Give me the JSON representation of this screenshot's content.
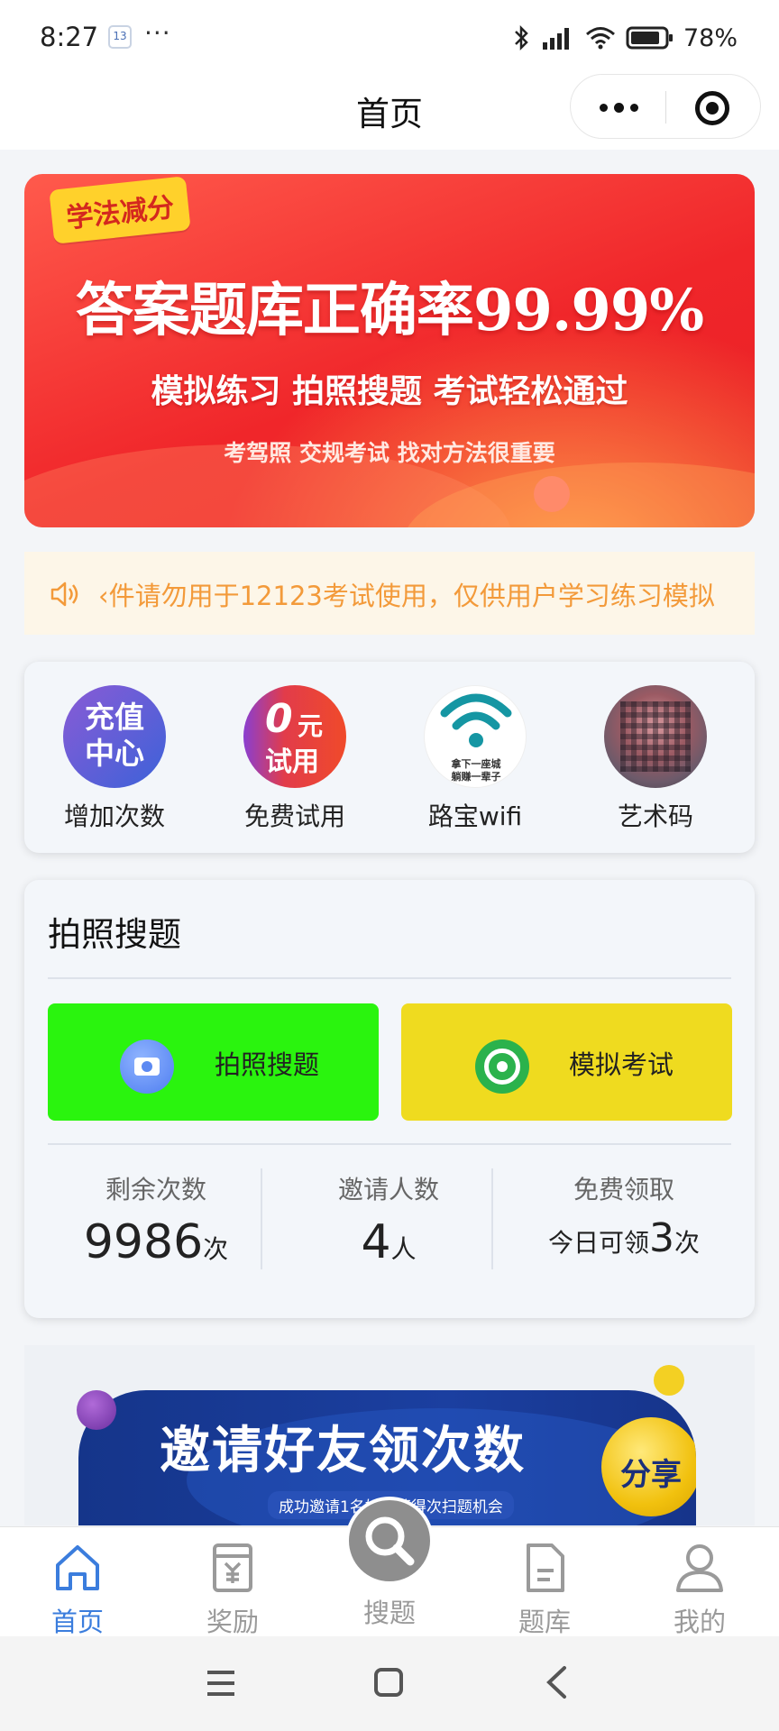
{
  "status_bar": {
    "time": "8:27",
    "calendar_badge": "13",
    "more_dots": "···",
    "battery_text": "78%"
  },
  "header": {
    "title": "首页"
  },
  "banner": {
    "tag": "学法减分",
    "headline": "答案题库正确率99.99%",
    "subline": "模拟练习 拍照搜题 考试轻松通过",
    "note": "考驾照 交规考试 找对方法很重要"
  },
  "notice": {
    "text": "‹件请勿用于12123考试使用，仅供用户学习练习模拟"
  },
  "quick_links": [
    {
      "icon_text_line1": "充值",
      "icon_text_line2": "中心",
      "label": "增加次数",
      "icon": "recharge-icon"
    },
    {
      "icon_text_big": "0",
      "icon_text_unit": "元",
      "icon_text_line2": "试用",
      "label": "免费试用",
      "icon": "free-trial-icon"
    },
    {
      "icon_caption_line1": "拿下一座城",
      "icon_caption_line2": "躺赚一辈子",
      "label": "路宝wifi",
      "icon": "wifi-icon"
    },
    {
      "label": "艺术码",
      "icon": "art-qr-icon"
    }
  ],
  "photo_search": {
    "title": "拍照搜题",
    "photo_button": "拍照搜题",
    "exam_button": "模拟考试",
    "stats": {
      "remaining_title": "剩余次数",
      "remaining_value": "9986",
      "remaining_unit": "次",
      "invited_title": "邀请人数",
      "invited_value": "4",
      "invited_unit": "人",
      "free_title": "免费领取",
      "free_prefix": "今日可领",
      "free_value": "3",
      "free_unit": "次"
    }
  },
  "invite": {
    "headline": "邀请好友领次数",
    "share": "分享",
    "subline": "成功邀请1名好友获得次扫题机会"
  },
  "tabbar": {
    "tabs": [
      {
        "label": "首页",
        "icon": "home-icon",
        "active": true
      },
      {
        "label": "奖励",
        "icon": "reward-icon",
        "active": false
      },
      {
        "label": "搜题",
        "icon": "search-icon",
        "active": false
      },
      {
        "label": "题库",
        "icon": "question-bank-icon",
        "active": false
      },
      {
        "label": "我的",
        "icon": "profile-icon",
        "active": false
      }
    ]
  },
  "colors": {
    "accent": "#3b7ddd",
    "notice_text": "#f39a3a",
    "photo_button": "#2af40e",
    "exam_button": "#efdb1f",
    "banner_red": "#f0262a"
  }
}
